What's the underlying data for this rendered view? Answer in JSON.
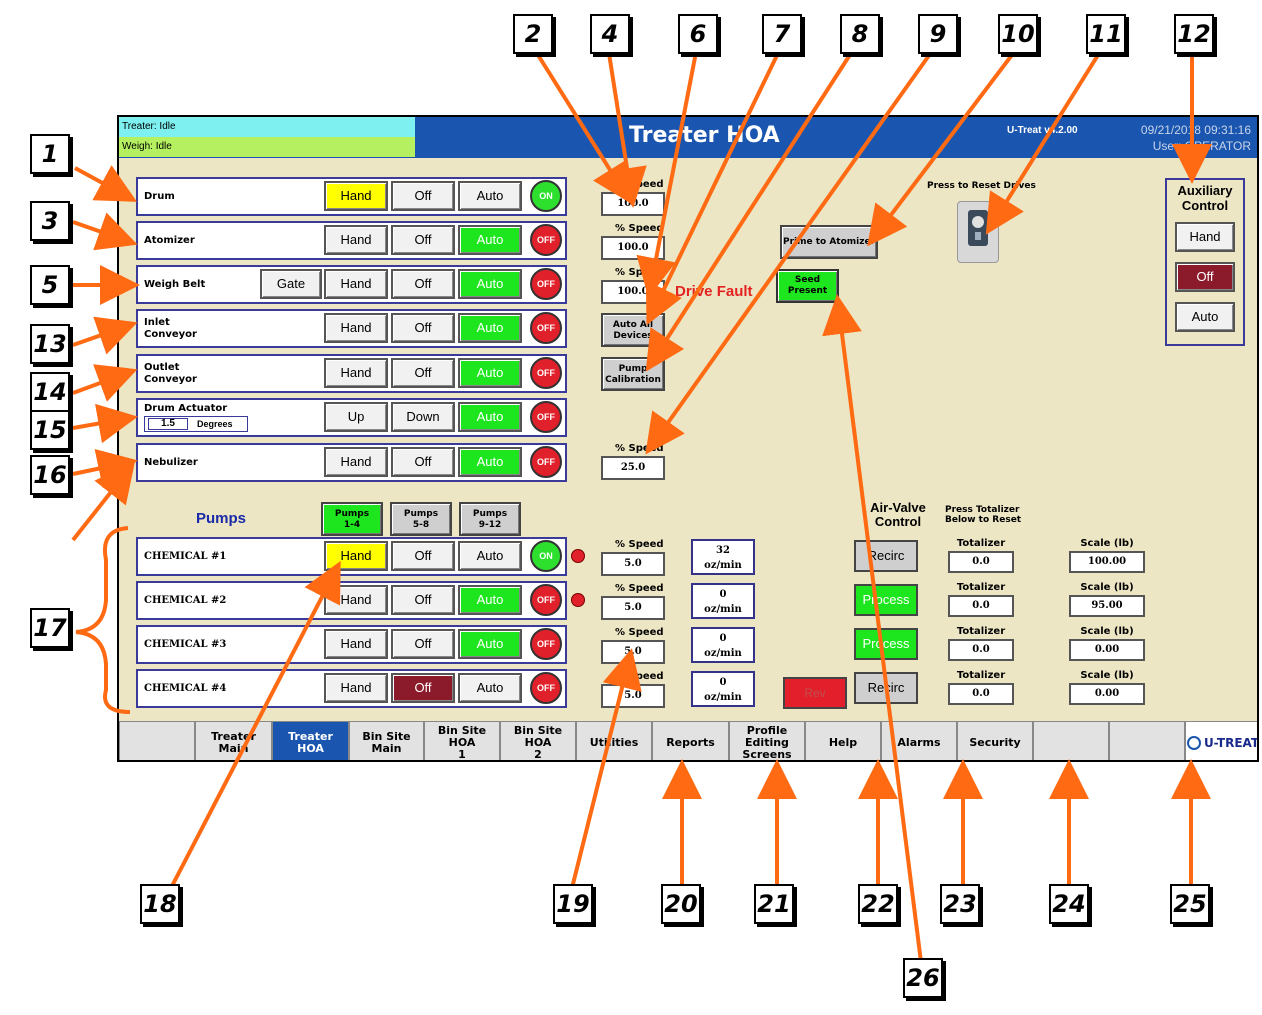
{
  "status": {
    "treater": "Treater: Idle",
    "weigh": "Weigh: Idle",
    "treater_color": "#7ff0f0",
    "weigh_color": "#b4f060"
  },
  "header": {
    "title": "Treater HOA",
    "version": "U-Treat v4.2.00",
    "datetime": "09/21/2018 09:31:16",
    "user": "User: OPERATOR"
  },
  "devices": [
    {
      "label": "Drum",
      "hand": "Hand",
      "off": "Off",
      "auto": "Auto",
      "active": "hand",
      "indicator": "ON"
    },
    {
      "label": "Atomizer",
      "hand": "Hand",
      "off": "Off",
      "auto": "Auto",
      "active": "auto",
      "indicator": "OFF"
    },
    {
      "label": "Weigh Belt",
      "gate": "Gate",
      "hand": "Hand",
      "off": "Off",
      "auto": "Auto",
      "active": "auto",
      "indicator": "OFF"
    },
    {
      "label": "Inlet\nConveyor",
      "hand": "Hand",
      "off": "Off",
      "auto": "Auto",
      "active": "auto",
      "indicator": "OFF"
    },
    {
      "label": "Outlet\nConveyor",
      "hand": "Hand",
      "off": "Off",
      "auto": "Auto",
      "active": "auto",
      "indicator": "OFF"
    },
    {
      "label": "Drum Actuator",
      "degrees_value": "1.5",
      "degrees_unit": "Degrees",
      "hand": "Up",
      "off": "Down",
      "auto": "Auto",
      "active": "auto",
      "indicator": "OFF"
    },
    {
      "label": "Nebulizer",
      "hand": "Hand",
      "off": "Off",
      "auto": "Auto",
      "active": "auto",
      "indicator": "OFF"
    }
  ],
  "speeds": {
    "label": "% Speed",
    "drum": "100.0",
    "atomizer": "100.0",
    "weigh_belt": "100.0",
    "nebulizer": "25.0"
  },
  "drive_fault": "Drive Fault",
  "buttons": {
    "auto_all": "Auto All\nDevices",
    "pump_cal": "Pump\nCalibration",
    "prime": "Prime to Atomizer",
    "seed_present": "Seed\nPresent",
    "rev": "Rev"
  },
  "reset_drives": "Press to Reset Drives",
  "auxiliary": {
    "title": "Auxiliary\nControl",
    "hand": "Hand",
    "off": "Off",
    "auto": "Auto"
  },
  "pumps": {
    "title": "Pumps",
    "groups": [
      "Pumps\n1-4",
      "Pumps\n5-8",
      "Pumps\n9-12"
    ],
    "chemicals": [
      {
        "label": "CHEMICAL #1",
        "hand": "Hand",
        "off": "Off",
        "auto": "Auto",
        "active": "hand",
        "indicator": "ON",
        "dot": true,
        "speed": "5.0",
        "flow": "32",
        "flow_unit": "oz/min",
        "valve": "Recirc",
        "valve_active": false,
        "totalizer": "0.0",
        "scale": "100.00"
      },
      {
        "label": "CHEMICAL #2",
        "hand": "Hand",
        "off": "Off",
        "auto": "Auto",
        "active": "auto",
        "indicator": "OFF",
        "dot": true,
        "speed": "5.0",
        "flow": "0",
        "flow_unit": "oz/min",
        "valve": "Process",
        "valve_active": true,
        "totalizer": "0.0",
        "scale": "95.00"
      },
      {
        "label": "CHEMICAL #3",
        "hand": "Hand",
        "off": "Off",
        "auto": "Auto",
        "active": "auto",
        "indicator": "OFF",
        "dot": false,
        "speed": "5.0",
        "flow": "0",
        "flow_unit": "oz/min",
        "valve": "Process",
        "valve_active": true,
        "totalizer": "0.0",
        "scale": "0.00"
      },
      {
        "label": "CHEMICAL #4",
        "hand": "Hand",
        "off": "Off",
        "auto": "Auto",
        "active": "off",
        "indicator": "OFF",
        "dot": false,
        "speed": "5.0",
        "flow": "0",
        "flow_unit": "oz/min",
        "valve": "Recirc",
        "valve_active": false,
        "totalizer": "0.0",
        "scale": "0.00"
      }
    ]
  },
  "air_valve": {
    "title": "Air-Valve\nControl"
  },
  "totalizer_header": "Press Totalizer\nBelow to Reset",
  "totalizer_label": "Totalizer",
  "scale_label": "Scale (lb)",
  "nav": [
    "",
    "Treater Main",
    "Treater HOA",
    "Bin Site\nMain",
    "Bin Site HOA\n1",
    "Bin Site HOA\n2",
    "Utilities",
    "Reports",
    "Profile\nEditing\nScreens",
    "Help",
    "Alarms",
    "Security",
    "",
    ""
  ],
  "logo": "U-TREAT",
  "callouts": [
    "1",
    "2",
    "3",
    "4",
    "5",
    "6",
    "7",
    "8",
    "9",
    "10",
    "11",
    "12",
    "13",
    "14",
    "15",
    "16",
    "17",
    "18",
    "19",
    "20",
    "21",
    "22",
    "23",
    "24",
    "25",
    "26"
  ],
  "colors": {
    "callout_arrow": "#ff6a13",
    "title_bar": "#1a56b0",
    "panel": "#ece6c4"
  }
}
